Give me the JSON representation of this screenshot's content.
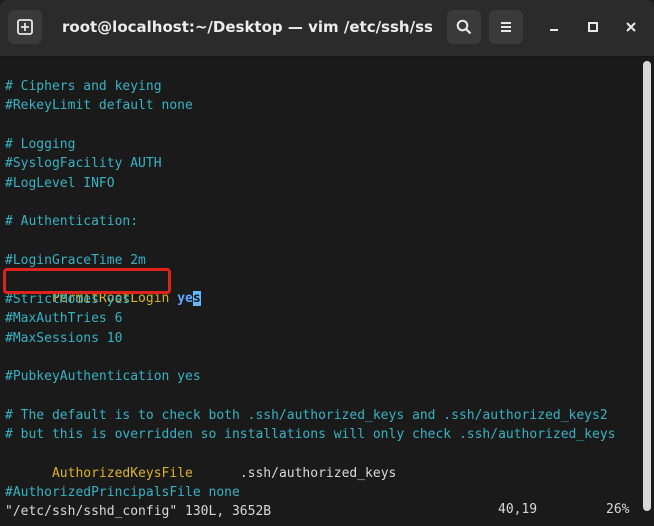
{
  "header": {
    "title": "root@localhost:~/Desktop — vim /etc/ssh/sshd_co…",
    "icons": {
      "new_tab": "new-tab-icon",
      "search": "search-icon",
      "menu": "menu-icon",
      "minimize": "minimize-icon",
      "maximize": "maximize-icon",
      "close": "close-icon"
    }
  },
  "editor": {
    "lines": [
      "# Ciphers and keying",
      "#RekeyLimit default none",
      "",
      "# Logging",
      "#SyslogFacility AUTH",
      "#LogLevel INFO",
      "",
      "# Authentication:",
      "",
      "#LoginGraceTime 2m",
      "PermitRootLogin yes",
      "#StrictModes yes",
      "#MaxAuthTries 6",
      "#MaxSessions 10",
      "",
      "#PubkeyAuthentication yes",
      "",
      "# The default is to check both .ssh/authorized_keys and .ssh/authorized_keys2",
      "# but this is overridden so installations will only check .ssh/authorized_keys",
      "AuthorizedKeysFile      .ssh/authorized_keys",
      "",
      "#AuthorizedPrincipalsFile none"
    ],
    "permit_root_login": {
      "key": "PermitRootLogin",
      "value_bold": "ye",
      "value_cursor": "s"
    },
    "authorized_keys_file": {
      "key": "AuthorizedKeysFile",
      "value": "      .ssh/authorized_keys"
    }
  },
  "status": {
    "left": "\"/etc/ssh/sshd_config\" 130L, 3652B",
    "position": "40,19",
    "percent": "26%"
  },
  "colors": {
    "comment": "#37b2c2",
    "key": "#d9b327",
    "highlight_box": "#e1221b",
    "cursor": "#62b8ff"
  }
}
